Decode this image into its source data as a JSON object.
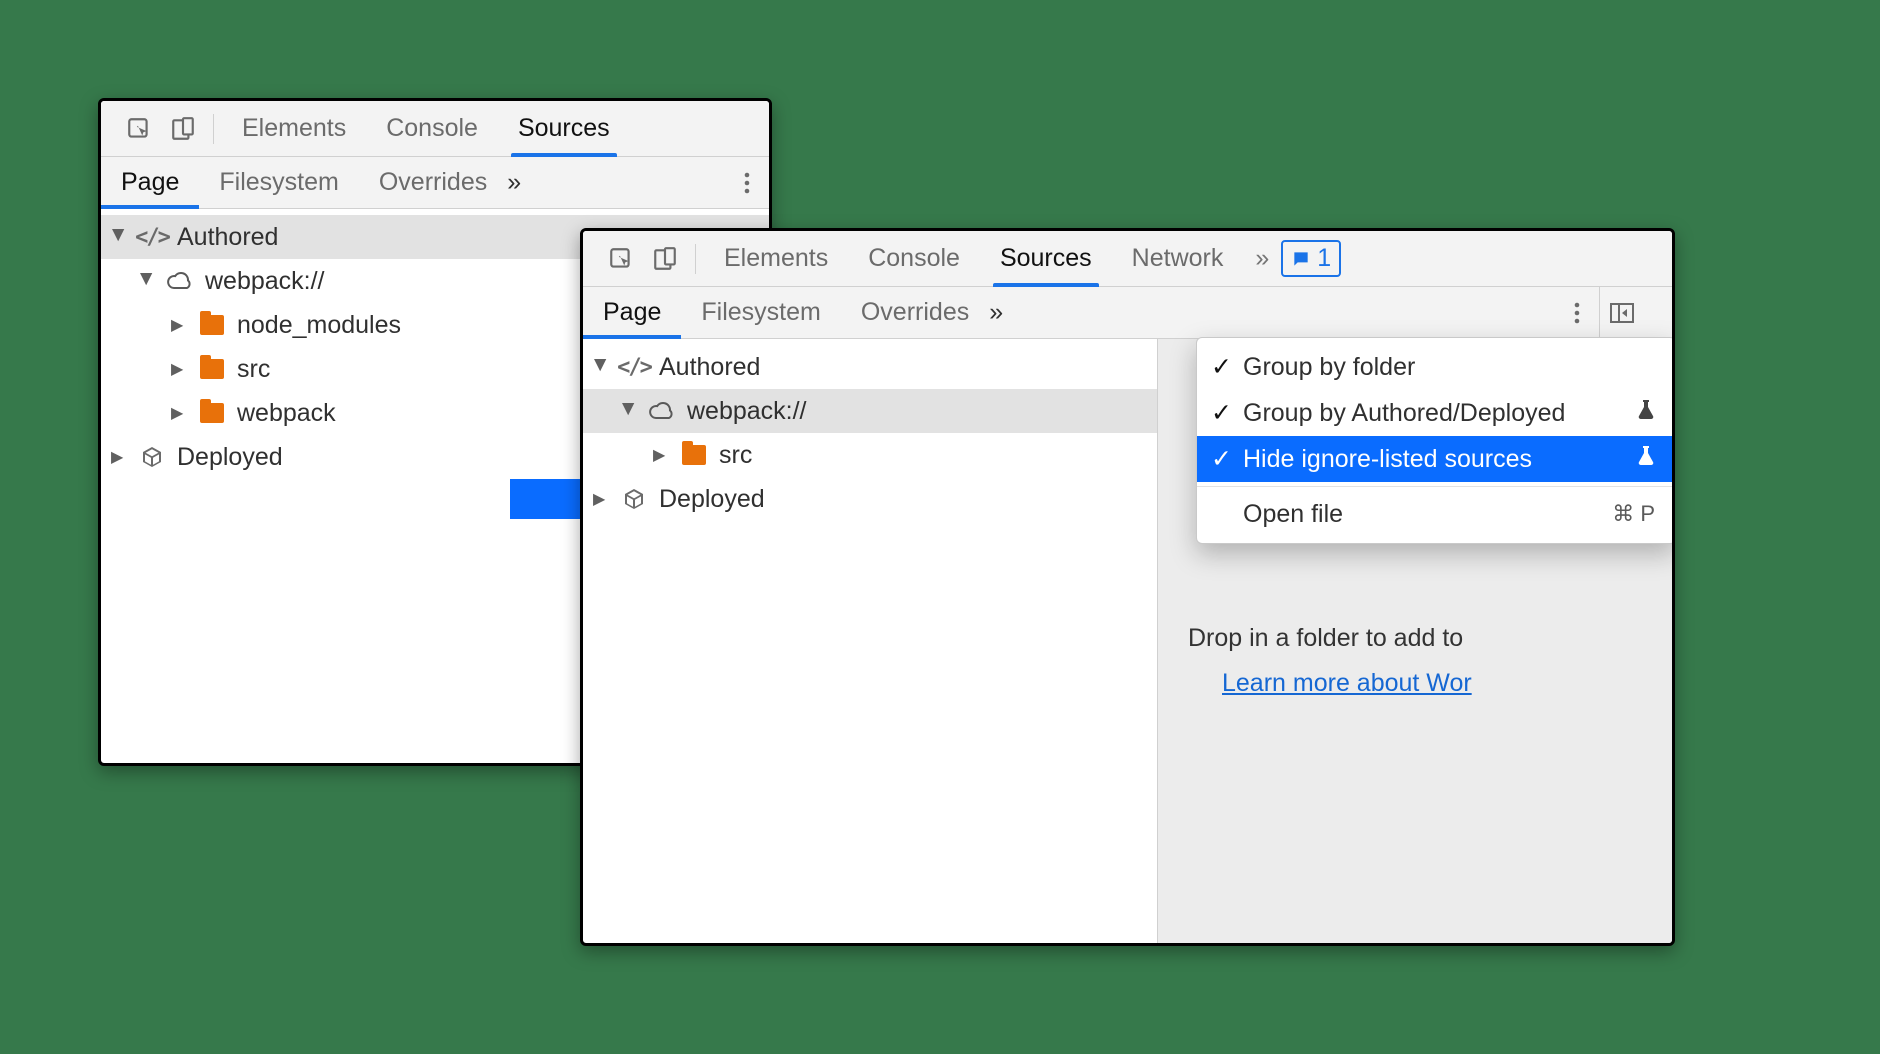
{
  "left_window": {
    "tabs": {
      "elements": "Elements",
      "console": "Console",
      "sources": "Sources"
    },
    "subtabs": {
      "page": "Page",
      "filesystem": "Filesystem",
      "overrides": "Overrides"
    },
    "tree": {
      "authored": "Authored",
      "webpack": "webpack://",
      "folders": {
        "node_modules": "node_modules",
        "src": "src",
        "webpack": "webpack"
      },
      "deployed": "Deployed"
    }
  },
  "right_window": {
    "tabs": {
      "elements": "Elements",
      "console": "Console",
      "sources": "Sources",
      "network": "Network"
    },
    "badge_count": "1",
    "subtabs": {
      "page": "Page",
      "filesystem": "Filesystem",
      "overrides": "Overrides"
    },
    "tree": {
      "authored": "Authored",
      "webpack": "webpack://",
      "folders": {
        "src": "src"
      },
      "deployed": "Deployed"
    },
    "menu": {
      "group_by_folder": "Group by folder",
      "group_by_authored": "Group by Authored/Deployed",
      "hide_ignore": "Hide ignore-listed sources",
      "open_file": "Open file",
      "open_file_kb": "⌘ P"
    },
    "hint_text": "Drop in a folder to add to",
    "hint_link": "Learn more about Wor"
  }
}
